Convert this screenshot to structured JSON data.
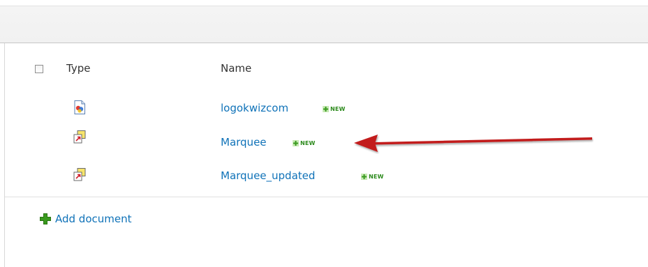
{
  "list": {
    "columns": {
      "type": "Type",
      "name": "Name"
    },
    "items": [
      {
        "name": "logokwizcom",
        "badge": "NEW",
        "icon": "image-file-icon"
      },
      {
        "name": "Marquee",
        "badge": "NEW",
        "icon": "web-part-file-icon"
      },
      {
        "name": "Marquee_updated",
        "badge": "NEW",
        "icon": "web-part-file-icon"
      }
    ],
    "add_document": "Add document"
  },
  "colors": {
    "link": "#0f72b8",
    "new_badge": "#2c8a1c",
    "arrow": "#c21a1a",
    "add_icon": "#3a9a1f"
  }
}
